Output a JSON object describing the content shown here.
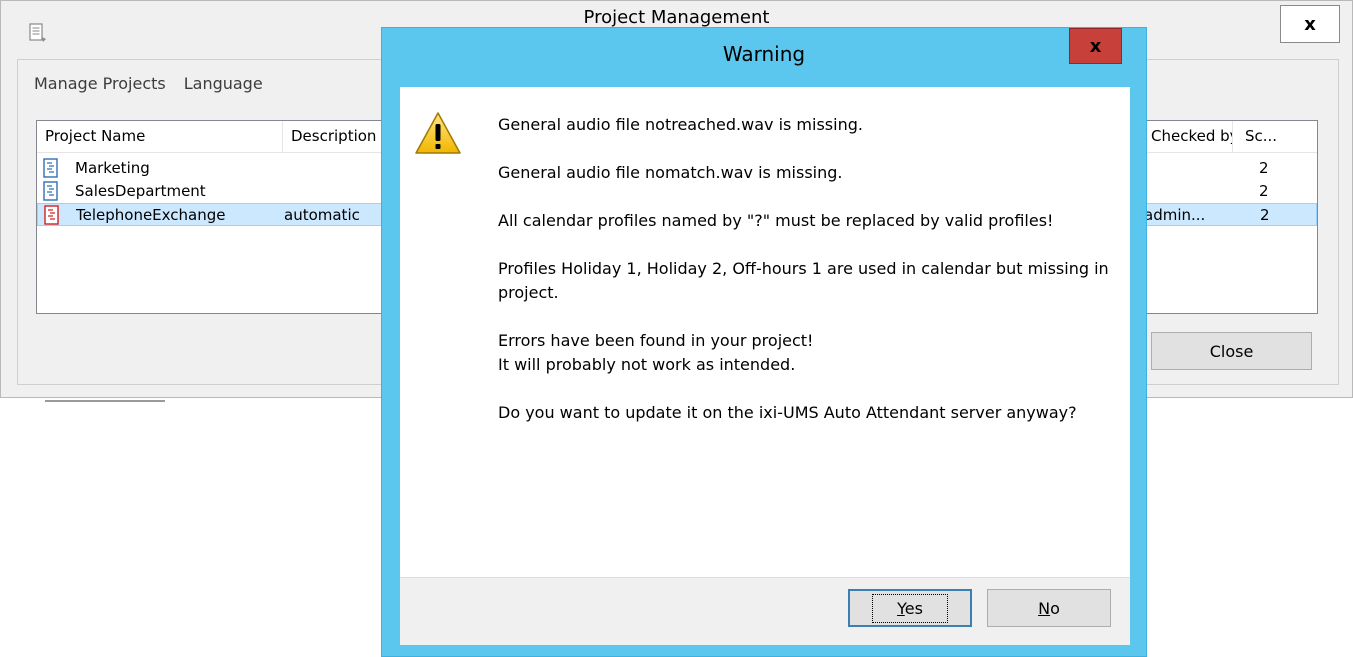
{
  "main_window": {
    "title": "Project Management",
    "close_label": "x",
    "menu": [
      "Manage Projects",
      "Language"
    ],
    "columns": [
      "Project Name",
      "Description",
      "Checked by",
      "Sc..."
    ],
    "rows": [
      {
        "name": "Marketing",
        "description": "",
        "checked": "",
        "sc": "2",
        "icon": "project-file-icon",
        "selected": false
      },
      {
        "name": "SalesDepartment",
        "description": "",
        "checked": "",
        "sc": "2",
        "icon": "project-file-icon",
        "selected": false
      },
      {
        "name": "TelephoneExchange",
        "description": "automatic",
        "checked": "admin...",
        "sc": "2",
        "icon": "project-file-error-icon",
        "selected": true
      }
    ],
    "close_button": "Close"
  },
  "dialog": {
    "title": "Warning",
    "close_label": "x",
    "icon": "warning-icon",
    "messages": {
      "m1": "General audio file notreached.wav is missing.",
      "m2": "General audio file nomatch.wav is missing.",
      "m3": "All calendar profiles named by \"?\" must be replaced by valid profiles!",
      "m4": "Profiles Holiday 1, Holiday 2, Off-hours 1 are used in calendar but missing in project.",
      "m5a": "Errors have been found in your project!",
      "m5b": "It will probably not work as intended.",
      "m6": "Do you want to update it on the ixi-UMS Auto Attendant server anyway?"
    },
    "buttons": {
      "yes_first": "Y",
      "yes_rest": "es",
      "no_first": "N",
      "no_rest": "o"
    }
  },
  "colors": {
    "dialog_frame": "#5bc7ef",
    "close_red": "#c7413a",
    "selection": "#cce8ff"
  }
}
